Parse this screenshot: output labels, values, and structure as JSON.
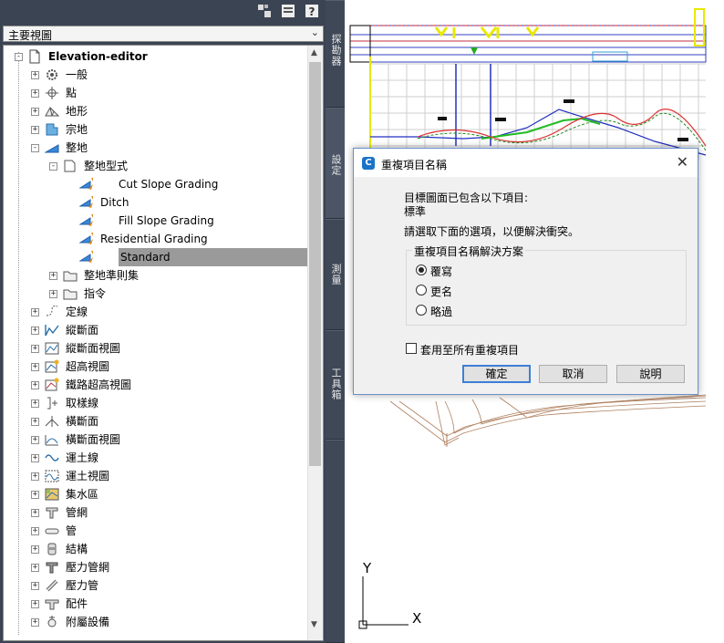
{
  "toolspace": {
    "view_selector": {
      "value": "主要視圖"
    },
    "root": {
      "label": "Elevation-editor"
    },
    "tree": [
      {
        "label": "一般",
        "icon": "gear-icon",
        "level": 1,
        "toggle": "+"
      },
      {
        "label": "點",
        "icon": "point-icon",
        "level": 1,
        "toggle": "+"
      },
      {
        "label": "地形",
        "icon": "surface-icon",
        "level": 1,
        "toggle": "+"
      },
      {
        "label": "宗地",
        "icon": "parcel-icon",
        "level": 1,
        "toggle": "+"
      },
      {
        "label": "整地",
        "icon": "grading-icon",
        "level": 1,
        "toggle": "-"
      },
      {
        "label": "整地型式",
        "icon": "folder-style-icon",
        "level": 2,
        "toggle": "-"
      },
      {
        "label": "Cut Slope Grading",
        "icon": "grading-style-icon",
        "level": 3,
        "indent": 1
      },
      {
        "label": "Ditch",
        "icon": "grading-style-icon",
        "level": 3,
        "indent": 0
      },
      {
        "label": "Fill Slope Grading",
        "icon": "grading-style-icon",
        "level": 3,
        "indent": 1
      },
      {
        "label": "Residential Grading",
        "icon": "grading-style-icon",
        "level": 3,
        "indent": 0
      },
      {
        "label": "Standard",
        "icon": "grading-style-icon",
        "level": 3,
        "indent": 1,
        "selected": true
      },
      {
        "label": "整地準則集",
        "icon": "folder-icon",
        "level": 2,
        "toggle": "+"
      },
      {
        "label": "指令",
        "icon": "folder-icon",
        "level": 2,
        "toggle": "+"
      },
      {
        "label": "定線",
        "icon": "alignment-icon",
        "level": 1,
        "toggle": "+"
      },
      {
        "label": "縱斷面",
        "icon": "profile-icon",
        "level": 1,
        "toggle": "+"
      },
      {
        "label": "縱斷面視圖",
        "icon": "profile-view-icon",
        "level": 1,
        "toggle": "+"
      },
      {
        "label": "超高視圖",
        "icon": "superelevation-view-icon",
        "level": 1,
        "toggle": "+"
      },
      {
        "label": "鐵路超高視圖",
        "icon": "rail-superelevation-icon",
        "level": 1,
        "toggle": "+"
      },
      {
        "label": "取樣線",
        "icon": "sample-line-icon",
        "level": 1,
        "toggle": "+"
      },
      {
        "label": "橫斷面",
        "icon": "section-icon",
        "level": 1,
        "toggle": "+"
      },
      {
        "label": "橫斷面視圖",
        "icon": "section-view-icon",
        "level": 1,
        "toggle": "+"
      },
      {
        "label": "運土線",
        "icon": "mass-haul-line-icon",
        "level": 1,
        "toggle": "+"
      },
      {
        "label": "運土視圖",
        "icon": "mass-haul-view-icon",
        "level": 1,
        "toggle": "+"
      },
      {
        "label": "集水區",
        "icon": "catchment-icon",
        "level": 1,
        "toggle": "+"
      },
      {
        "label": "管網",
        "icon": "pipe-network-icon",
        "level": 1,
        "toggle": "+"
      },
      {
        "label": "管",
        "icon": "pipe-icon",
        "level": 1,
        "toggle": "+"
      },
      {
        "label": "結構",
        "icon": "structure-icon",
        "level": 1,
        "toggle": "+"
      },
      {
        "label": "壓力管網",
        "icon": "pressure-network-icon",
        "level": 1,
        "toggle": "+"
      },
      {
        "label": "壓力管",
        "icon": "pressure-pipe-icon",
        "level": 1,
        "toggle": "+"
      },
      {
        "label": "配件",
        "icon": "fitting-icon",
        "level": 1,
        "toggle": "+"
      },
      {
        "label": "附屬設備",
        "icon": "appurtenance-icon",
        "level": 1,
        "toggle": "+"
      }
    ],
    "tabs": [
      "探勘器",
      "設定",
      "測量",
      "工具箱"
    ]
  },
  "dialog": {
    "title": "重複項目名稱",
    "message_line1": "目標圖面已包含以下項目:",
    "item_name": "標準",
    "instruction": "請選取下面的選項，以便解決衝突。",
    "group_title": "重複項目名稱解決方案",
    "options": [
      {
        "label": "覆寫",
        "selected": true
      },
      {
        "label": "更名",
        "selected": false
      },
      {
        "label": "略過",
        "selected": false
      }
    ],
    "apply_all_label": "套用至所有重複項目",
    "apply_all_checked": false,
    "buttons": {
      "ok": "確定",
      "cancel": "取消",
      "help": "說明"
    }
  },
  "drawing": {
    "ucs_x": "X",
    "ucs_y": "Y"
  },
  "colors": {
    "panel_bg": "#3b4453",
    "selection": "#9a9a9a",
    "accent": "#3c7fd5"
  }
}
